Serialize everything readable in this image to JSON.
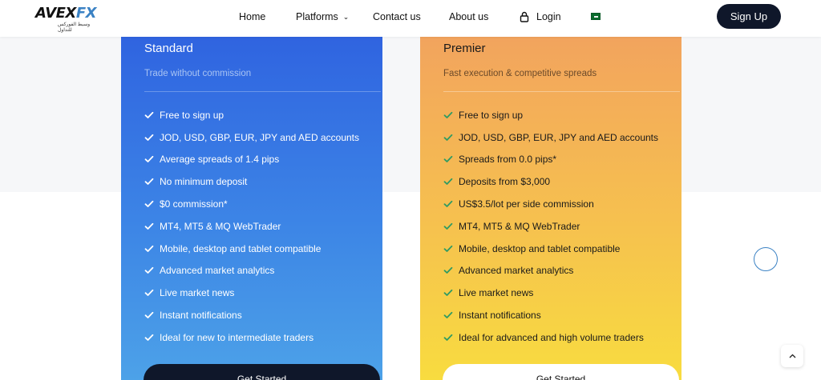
{
  "header": {
    "logo": {
      "text_main": "AVEX",
      "text_accent": "FX",
      "tagline": "وسيط الفوركس للتداول"
    },
    "nav": {
      "home": "Home",
      "platforms": "Platforms",
      "contact": "Contact us",
      "about": "About us",
      "login": "Login"
    },
    "signup_label": "Sign Up"
  },
  "cards": {
    "standard": {
      "title": "Standard",
      "subtitle": "Trade without commission",
      "features": [
        "Free to sign up",
        "JOD, USD, GBP, EUR, JPY and AED accounts",
        "Average spreads of 1.4 pips",
        "No minimum deposit",
        "$0 commission*",
        "MT4, MT5 & MQ WebTrader",
        "Mobile, desktop and tablet compatible",
        "Advanced market analytics",
        "Live market news",
        "Instant notifications",
        "Ideal for new to intermediate traders"
      ],
      "cta": "Get Started"
    },
    "premier": {
      "title": "Premier",
      "subtitle": "Fast  execution & competitive spreads",
      "features": [
        "Free to sign up",
        "JOD, USD, GBP, EUR, JPY and AED accounts",
        "Spreads from 0.0 pips*",
        "Deposits from $3,000",
        "US$3.5/lot per side commission",
        "MT4, MT5 & MQ WebTrader",
        "Mobile, desktop and tablet compatible",
        "Advanced market analytics",
        "Live market news",
        "Instant notifications",
        "Ideal for advanced and high volume traders"
      ],
      "cta": "Get Started"
    }
  },
  "colors": {
    "standard_check": "#ffffff",
    "premier_check": "#2e9b63",
    "dark": "#0f172a",
    "brand_blue": "#3b82c4"
  },
  "icons": {
    "nav_chevron": "chevron-down-icon",
    "login": "lock-icon",
    "language": "flag-icon",
    "feature": "check-icon",
    "scroll_top": "chevron-up-icon"
  }
}
